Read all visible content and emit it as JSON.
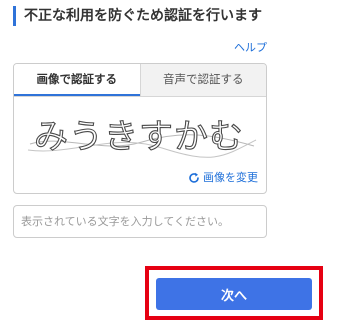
{
  "header": {
    "title": "不正な利用を防ぐため認証を行います",
    "help_label": "ヘルプ"
  },
  "captcha": {
    "tabs": [
      {
        "label": "画像で認証する",
        "active": true
      },
      {
        "label": "音声で認証する",
        "active": false
      }
    ],
    "image_text": "みうきすかむ",
    "change_image_label": "画像を変更"
  },
  "answer": {
    "placeholder": "表示されている文字を入力してください。",
    "value": ""
  },
  "actions": {
    "next_label": "次へ"
  },
  "colors": {
    "accent": "#2f73d9",
    "link": "#1e6fd9",
    "button": "#3e73e6",
    "highlight": "#e60012"
  }
}
